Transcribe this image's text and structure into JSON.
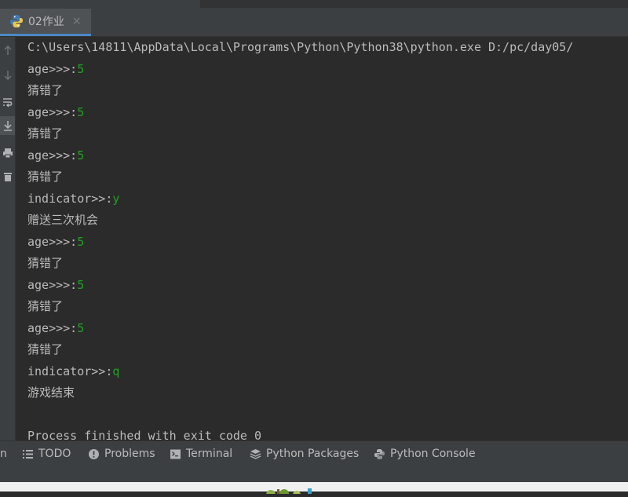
{
  "tab": {
    "label": "02作业",
    "close_glyph": "×"
  },
  "console_lines": [
    {
      "parts": [
        {
          "t": "C:\\Users\\14811\\AppData\\Local\\Programs\\Python\\Python38\\python.exe D:/pc/day05/",
          "k": "out"
        }
      ]
    },
    {
      "parts": [
        {
          "t": "age>>>:",
          "k": "out"
        },
        {
          "t": "5",
          "k": "inp"
        }
      ]
    },
    {
      "parts": [
        {
          "t": "猜错了",
          "k": "cjk"
        }
      ]
    },
    {
      "parts": [
        {
          "t": "age>>>:",
          "k": "out"
        },
        {
          "t": "5",
          "k": "inp"
        }
      ]
    },
    {
      "parts": [
        {
          "t": "猜错了",
          "k": "cjk"
        }
      ]
    },
    {
      "parts": [
        {
          "t": "age>>>:",
          "k": "out"
        },
        {
          "t": "5",
          "k": "inp"
        }
      ]
    },
    {
      "parts": [
        {
          "t": "猜错了",
          "k": "cjk"
        }
      ]
    },
    {
      "parts": [
        {
          "t": "indicator>>:",
          "k": "out"
        },
        {
          "t": "y",
          "k": "inp"
        }
      ]
    },
    {
      "parts": [
        {
          "t": "赠送三次机会",
          "k": "cjk"
        }
      ]
    },
    {
      "parts": [
        {
          "t": "age>>>:",
          "k": "out"
        },
        {
          "t": "5",
          "k": "inp"
        }
      ]
    },
    {
      "parts": [
        {
          "t": "猜错了",
          "k": "cjk"
        }
      ]
    },
    {
      "parts": [
        {
          "t": "age>>>:",
          "k": "out"
        },
        {
          "t": "5",
          "k": "inp"
        }
      ]
    },
    {
      "parts": [
        {
          "t": "猜错了",
          "k": "cjk"
        }
      ]
    },
    {
      "parts": [
        {
          "t": "age>>>:",
          "k": "out"
        },
        {
          "t": "5",
          "k": "inp"
        }
      ]
    },
    {
      "parts": [
        {
          "t": "猜错了",
          "k": "cjk"
        }
      ]
    },
    {
      "parts": [
        {
          "t": "indicator>>:",
          "k": "out"
        },
        {
          "t": "q",
          "k": "inp"
        }
      ]
    },
    {
      "parts": [
        {
          "t": "游戏结束",
          "k": "cjk"
        }
      ]
    },
    {
      "parts": [
        {
          "t": "",
          "k": "out"
        }
      ]
    },
    {
      "parts": [
        {
          "t": "Process finished with exit code 0",
          "k": "out"
        }
      ]
    }
  ],
  "bottom_bar": {
    "cut_label": "n",
    "todo": "TODO",
    "problems": "Problems",
    "terminal": "Terminal",
    "python_packages": "Python Packages",
    "python_console": "Python Console"
  },
  "gutter_icons": [
    "arrow-up-icon",
    "arrow-down-icon",
    "soft-wrap-icon",
    "scroll-to-end-icon",
    "print-icon",
    "trash-icon"
  ],
  "colors": {
    "input_text": "#1fa41f",
    "output_text": "#bbbbbb",
    "background": "#2b2b2b",
    "tab_underline": "#4a88c7"
  }
}
